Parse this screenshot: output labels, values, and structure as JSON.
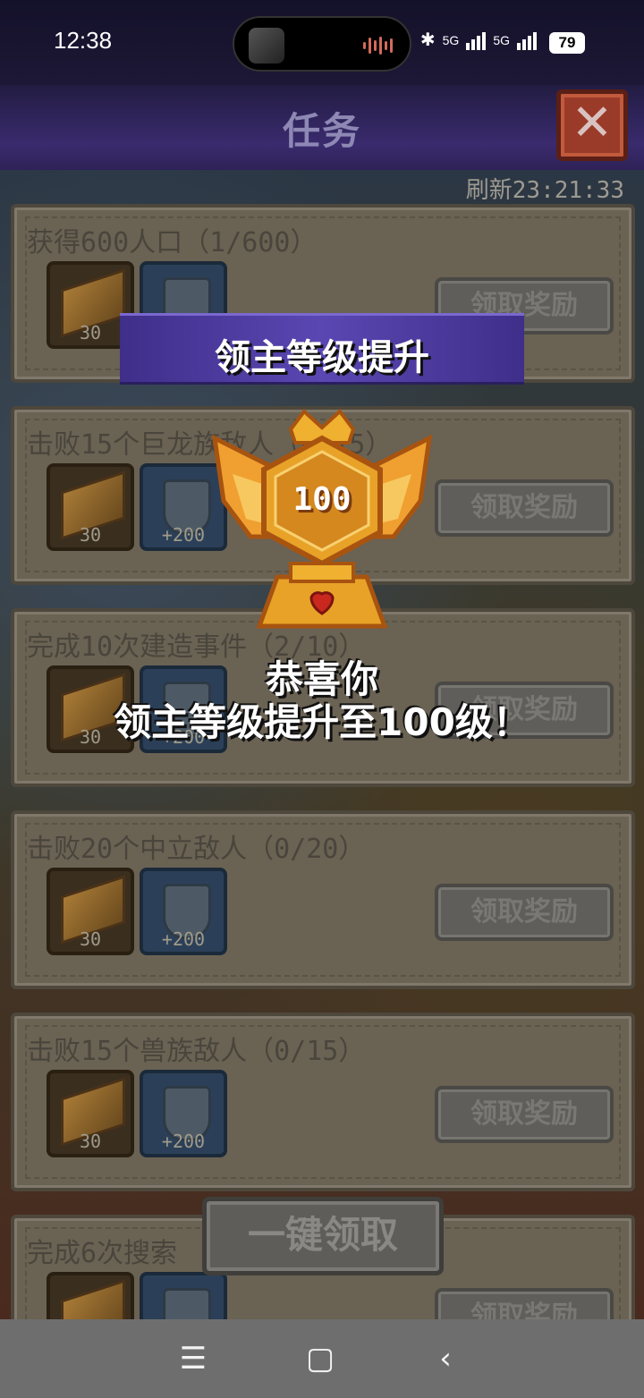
{
  "status_bar": {
    "time": "12:38",
    "network1": "5G",
    "network2": "5G",
    "battery": "79"
  },
  "header": {
    "title": "任务",
    "close_icon": "close-icon"
  },
  "refresh_text": "刷新23:21:33",
  "tasks": [
    {
      "title": "获得600人口（1/600）",
      "reward1": "30",
      "reward2": "",
      "button": "领取奖励"
    },
    {
      "title": "击败15个巨龙族敌人（0/15）",
      "reward1": "30",
      "reward2": "+200",
      "button": "领取奖励"
    },
    {
      "title": "完成10次建造事件（2/10）",
      "reward1": "30",
      "reward2": "+200",
      "button": "领取奖励"
    },
    {
      "title": "击败20个中立敌人（0/20）",
      "reward1": "30",
      "reward2": "+200",
      "button": "领取奖励"
    },
    {
      "title": "击败15个兽族敌人（0/15）",
      "reward1": "30",
      "reward2": "+200",
      "button": "领取奖励"
    },
    {
      "title": "完成6次搜索",
      "reward1": "",
      "reward2": "",
      "button": "领取奖励"
    }
  ],
  "popup": {
    "banner": "领主等级提升",
    "level": "100",
    "line1": "恭喜你",
    "line2": "领主等级提升至100级！"
  },
  "one_click": "一键领取",
  "nav": {
    "menu_icon": "menu-icon",
    "home_icon": "home-icon",
    "back_icon": "back-icon"
  },
  "colors": {
    "header_purple": "#3a2b6e",
    "banner_purple": "#5a47b2",
    "medal_gold": "#e8a228"
  }
}
